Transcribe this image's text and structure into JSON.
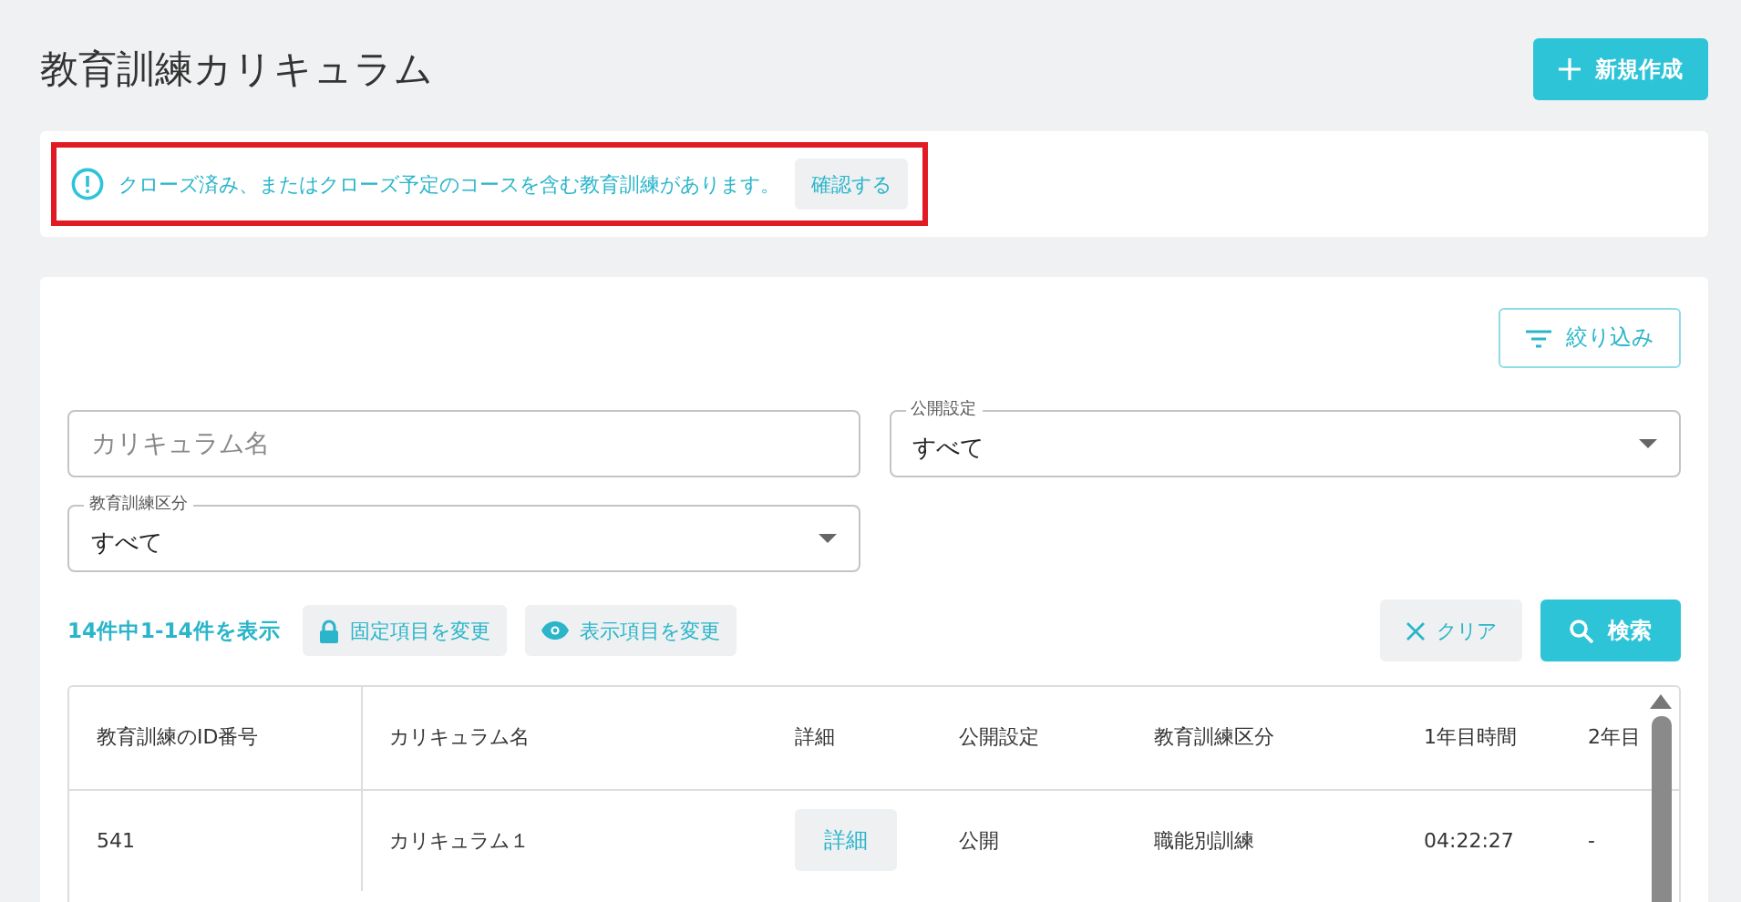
{
  "page_title": "教育訓練カリキュラム",
  "new_button": {
    "label": "新規作成"
  },
  "notice": {
    "message": "クローズ済み、またはクローズ予定のコースを含む教育訓練があります。",
    "action": "確認する",
    "highlighted": true
  },
  "filter_button": {
    "label": "絞り込み"
  },
  "filters": [
    {
      "kind": "text",
      "placeholder": "カリキュラム名"
    },
    {
      "kind": "select",
      "label": "公開設定",
      "value": "すべて"
    },
    {
      "kind": "select",
      "label": "教育訓練区分",
      "value": "すべて"
    }
  ],
  "toolbar": {
    "count": "14件中1-14件を表示",
    "fixed_button": "固定項目を変更",
    "columns_button": "表示項目を変更",
    "clear_button": "クリア",
    "search_button": "検索"
  },
  "table": {
    "columns": [
      "教育訓練のID番号",
      "カリキュラム名",
      "詳細",
      "公開設定",
      "教育訓練区分",
      "1年目時間",
      "2年目"
    ],
    "rows": [
      {
        "cells": [
          "541",
          "カリキュラム１",
          "詳細",
          "公開",
          "職能別訓練",
          "04:22:27",
          "-"
        ]
      }
    ]
  }
}
